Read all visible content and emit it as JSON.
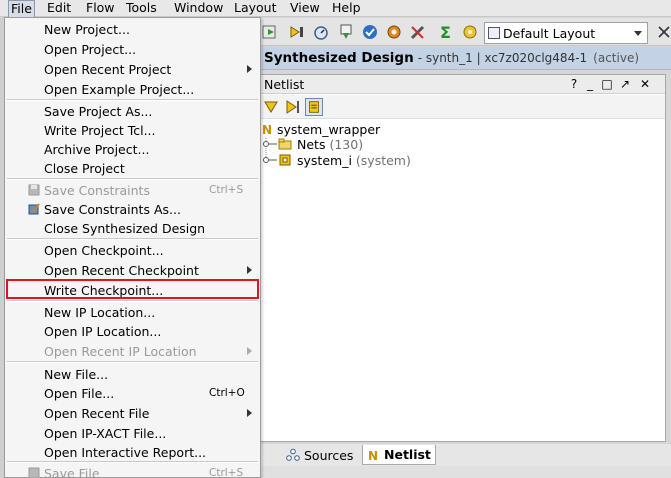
{
  "menubar": {
    "items": [
      {
        "label": "File"
      },
      {
        "label": "Edit"
      },
      {
        "label": "Flow"
      },
      {
        "label": "Tools"
      },
      {
        "label": "Window"
      },
      {
        "label": "Layout"
      },
      {
        "label": "View"
      },
      {
        "label": "Help"
      }
    ]
  },
  "toolbar": {
    "layout_select_value": "Default Layout",
    "icons": [
      "run-icon",
      "bitstream-icon",
      "timer-icon",
      "download-icon",
      "check-icon",
      "settings-gear-icon",
      "wrench-icon",
      "sigma-icon",
      "gear-wrench-icon"
    ]
  },
  "design_header": {
    "title": "Synthesized Design",
    "run": "- synth_1 | xc7z020clg484-1",
    "status": "(active)"
  },
  "netlist": {
    "title": "Netlist",
    "controls": [
      "?",
      "_",
      "□",
      "↗",
      "✕"
    ],
    "root": "system_wrapper",
    "nodes": [
      {
        "name": "Nets",
        "count": "(130)"
      },
      {
        "name": "system_i",
        "detail": "(system)"
      }
    ]
  },
  "bottom_tabs": {
    "sources": "Sources",
    "netlist": "Netlist"
  },
  "file_menu": {
    "items": [
      {
        "label": "New Project..."
      },
      {
        "label": "Open Project..."
      },
      {
        "label": "Open Recent Project"
      },
      {
        "label": "Open Example Project..."
      },
      {
        "label": "Save Project As..."
      },
      {
        "label": "Write Project Tcl..."
      },
      {
        "label": "Archive Project..."
      },
      {
        "label": "Close Project"
      },
      {
        "label": "Save Constraints",
        "shortcut": "Ctrl+S"
      },
      {
        "label": "Save Constraints As..."
      },
      {
        "label": "Close Synthesized Design"
      },
      {
        "label": "Open Checkpoint..."
      },
      {
        "label": "Open Recent Checkpoint"
      },
      {
        "label": "Write Checkpoint..."
      },
      {
        "label": "New IP Location..."
      },
      {
        "label": "Open IP Location..."
      },
      {
        "label": "Open Recent IP Location"
      },
      {
        "label": "New File..."
      },
      {
        "label": "Open File...",
        "shortcut": "Ctrl+O"
      },
      {
        "label": "Open Recent File"
      },
      {
        "label": "Open IP-XACT File..."
      },
      {
        "label": "Open Interactive Report..."
      },
      {
        "label": "Save File",
        "shortcut": "Ctrl+S"
      }
    ],
    "highlighted_color": "#e0141b"
  }
}
